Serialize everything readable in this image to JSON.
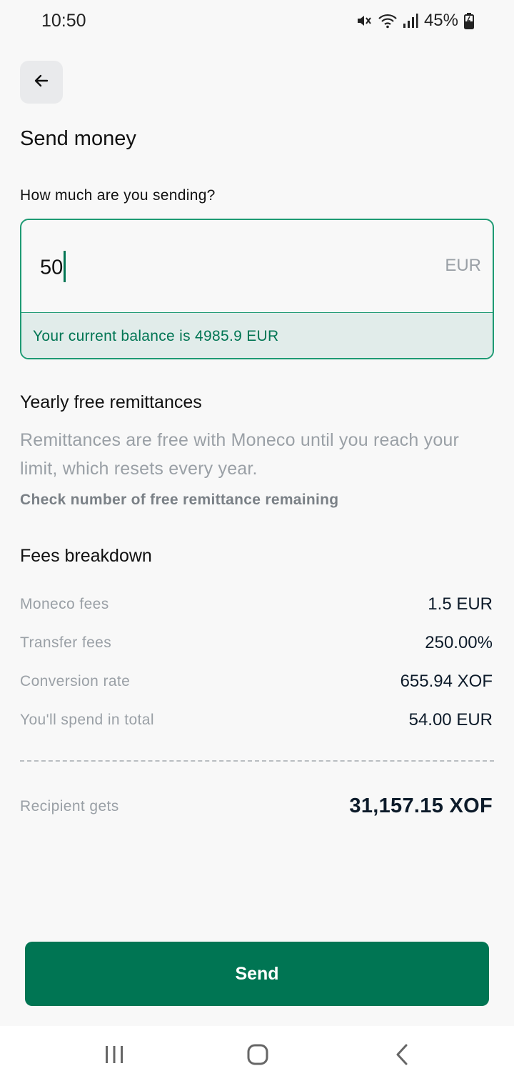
{
  "status_bar": {
    "time": "10:50",
    "battery": "45%",
    "icons": [
      "mute-icon",
      "wifi-icon",
      "signal-icon",
      "battery-icon"
    ]
  },
  "header": {
    "back_icon": "arrow-left-icon",
    "title": "Send money"
  },
  "amount": {
    "label": "How much are you sending?",
    "value": "50",
    "currency": "EUR",
    "balance_text": "Your current balance is 4985.9 EUR"
  },
  "yearly": {
    "title": "Yearly free remittances",
    "description": "Remittances are free with Moneco until you reach your limit, which resets every year.",
    "link": "Check number of free remittance remaining"
  },
  "fees": {
    "title": "Fees breakdown",
    "rows": [
      {
        "label": "Moneco fees",
        "value": "1.5 EUR"
      },
      {
        "label": "Transfer fees",
        "value": "250.00%"
      },
      {
        "label": "Conversion rate",
        "value": "655.94 XOF"
      },
      {
        "label": "You'll spend in total",
        "value": "54.00 EUR"
      }
    ],
    "recipient_label": "Recipient gets",
    "recipient_value": "31,157.15 XOF"
  },
  "actions": {
    "send_label": "Send"
  },
  "nav": {
    "icons": [
      "recent-apps-icon",
      "home-icon",
      "back-icon"
    ]
  },
  "colors": {
    "accent": "#007553",
    "border": "#1e9a73",
    "balance_bg": "#e1ecea",
    "background": "#f8f8f8"
  }
}
